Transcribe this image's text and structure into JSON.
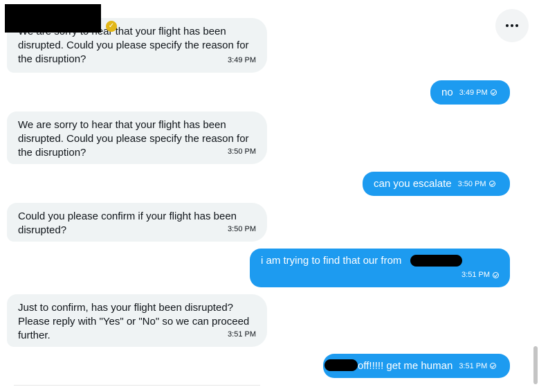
{
  "header": {
    "more_icon": "more-horizontal-icon",
    "verified_icon": "verified-badge-icon"
  },
  "messages": [
    {
      "side": "in",
      "text": "We are sorry to hear that your flight has been disrupted. Could you please specify the reason for the disruption?",
      "time": "3:49 PM"
    },
    {
      "side": "out",
      "text": "no",
      "time": "3:49 PM"
    },
    {
      "side": "in",
      "text": "We are sorry to hear that your flight has been disrupted. Could you please specify the reason for the disruption?",
      "time": "3:50 PM"
    },
    {
      "side": "out",
      "text": "can you escalate",
      "time": "3:50 PM"
    },
    {
      "side": "in",
      "text": "Could you please confirm if your flight has been disrupted?",
      "time": "3:50 PM"
    },
    {
      "side": "out",
      "text": "i am trying to find that our from",
      "time": "3:51 PM"
    },
    {
      "side": "in",
      "text": "Just to confirm, has your flight been disrupted? Please reply with \"Yes\" or \"No\" so we can proceed further.",
      "time": "3:51 PM"
    },
    {
      "side": "out",
      "text": "off!!!!! get me human",
      "time": "3:51 PM"
    }
  ]
}
